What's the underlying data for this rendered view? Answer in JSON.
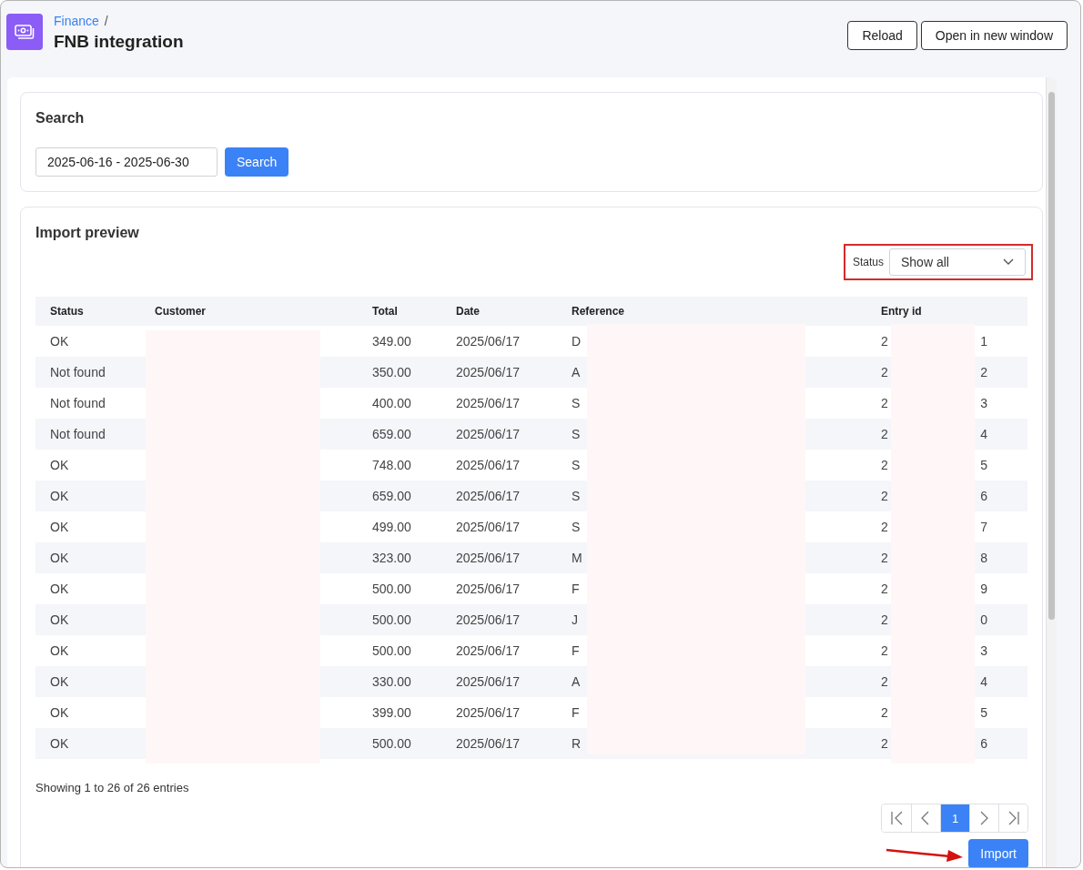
{
  "header": {
    "breadcrumb": "Finance",
    "separator": "/",
    "title": "FNB integration",
    "buttons": [
      "Reload",
      "Open in new window"
    ]
  },
  "search": {
    "title": "Search",
    "date_range": "2025-06-16 - 2025-06-30",
    "button": "Search"
  },
  "import_preview": {
    "title": "Import preview",
    "status_filter": {
      "label": "Status",
      "value": "Show all"
    },
    "table": {
      "columns": [
        "Status",
        "Customer",
        "Total",
        "Date",
        "Reference",
        "Entry id"
      ],
      "rows": [
        {
          "status": "OK",
          "total": "349.00",
          "date": "2025/06/17",
          "reference": "D",
          "entry_id_start": "2",
          "entry_id_end": "1"
        },
        {
          "status": "Not found",
          "total": "350.00",
          "date": "2025/06/17",
          "reference": "A",
          "entry_id_start": "2",
          "entry_id_end": "2"
        },
        {
          "status": "Not found",
          "total": "400.00",
          "date": "2025/06/17",
          "reference": "S",
          "entry_id_start": "2",
          "entry_id_end": "3"
        },
        {
          "status": "Not found",
          "total": "659.00",
          "date": "2025/06/17",
          "reference": "S",
          "entry_id_start": "2",
          "entry_id_end": "4"
        },
        {
          "status": "OK",
          "total": "748.00",
          "date": "2025/06/17",
          "reference": "S",
          "entry_id_start": "2",
          "entry_id_end": "5"
        },
        {
          "status": "OK",
          "total": "659.00",
          "date": "2025/06/17",
          "reference": "S",
          "entry_id_start": "2",
          "entry_id_end": "6"
        },
        {
          "status": "OK",
          "total": "499.00",
          "date": "2025/06/17",
          "reference": "S",
          "entry_id_start": "2",
          "entry_id_end": "7"
        },
        {
          "status": "OK",
          "total": "323.00",
          "date": "2025/06/17",
          "reference": "M",
          "entry_id_start": "2",
          "entry_id_end": "8"
        },
        {
          "status": "OK",
          "total": "500.00",
          "date": "2025/06/17",
          "reference": "F",
          "entry_id_start": "2",
          "entry_id_end": "9"
        },
        {
          "status": "OK",
          "total": "500.00",
          "date": "2025/06/17",
          "reference": "J",
          "entry_id_start": "2",
          "entry_id_end": "0"
        },
        {
          "status": "OK",
          "total": "500.00",
          "date": "2025/06/17",
          "reference": "F",
          "entry_id_start": "2",
          "entry_id_end": "3"
        },
        {
          "status": "OK",
          "total": "330.00",
          "date": "2025/06/17",
          "reference": "A",
          "entry_id_start": "2",
          "entry_id_end": "4"
        },
        {
          "status": "OK",
          "total": "399.00",
          "date": "2025/06/17",
          "reference": "F",
          "entry_id_start": "2",
          "entry_id_end": "5"
        },
        {
          "status": "OK",
          "total": "500.00",
          "date": "2025/06/17",
          "reference": "R",
          "entry_id_start": "2",
          "entry_id_end": "6"
        }
      ]
    },
    "summary": "Showing 1 to 26 of 26 entries",
    "pagination": [
      {
        "kind": "first",
        "selected": false
      },
      {
        "kind": "prev",
        "selected": false
      },
      {
        "kind": "page",
        "label": "1",
        "selected": true
      },
      {
        "kind": "next",
        "selected": false
      },
      {
        "kind": "last",
        "selected": false
      }
    ],
    "import_button": "Import"
  }
}
